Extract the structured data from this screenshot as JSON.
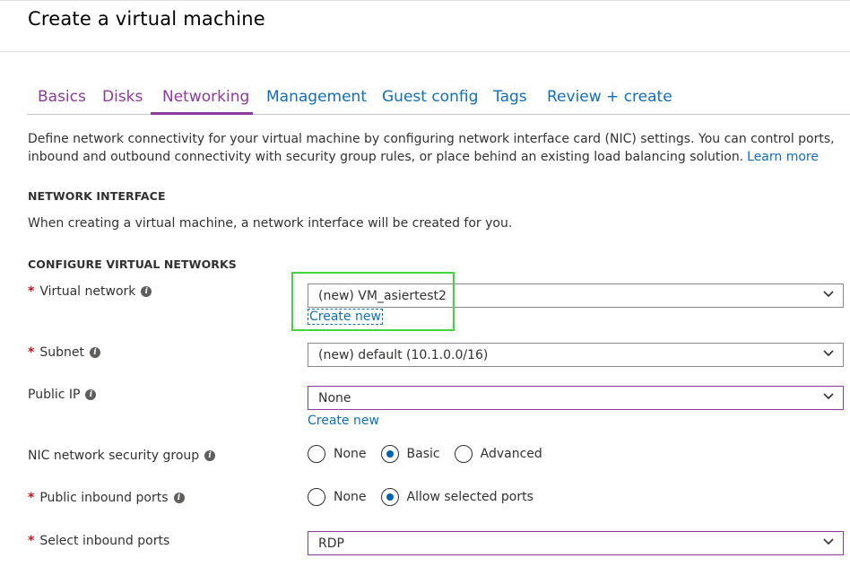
{
  "page": {
    "title": "Create a virtual machine"
  },
  "tabs": [
    {
      "label": "Basics"
    },
    {
      "label": "Disks"
    },
    {
      "label": "Networking"
    },
    {
      "label": "Management"
    },
    {
      "label": "Guest config"
    },
    {
      "label": "Tags"
    },
    {
      "label": "Review + create"
    }
  ],
  "description": {
    "text": "Define network connectivity for your virtual machine by configuring network interface card (NIC) settings. You can control ports, inbound and outbound connectivity with security group rules, or place behind an existing load balancing solution.",
    "learn_more": "Learn more"
  },
  "network_interface": {
    "heading": "NETWORK INTERFACE",
    "text": "When creating a virtual machine, a network interface will be created for you."
  },
  "configure_vnet": {
    "heading": "CONFIGURE VIRTUAL NETWORKS"
  },
  "fields": {
    "required_marker": "*",
    "info_glyph": "i",
    "virtual_network": {
      "label": "Virtual network",
      "value": "(new) VM_asiertest2",
      "create_new": "Create new"
    },
    "subnet": {
      "label": "Subnet",
      "value": "(new) default (10.1.0.0/16)"
    },
    "public_ip": {
      "label": "Public IP",
      "value": "None",
      "create_new": "Create new"
    },
    "nic_nsg": {
      "label": "NIC network security group",
      "options": [
        "None",
        "Basic",
        "Advanced"
      ],
      "selected": "Basic"
    },
    "public_inbound_ports": {
      "label": "Public inbound ports",
      "options": [
        "None",
        "Allow selected ports"
      ],
      "selected": "Allow selected ports"
    },
    "select_inbound_ports": {
      "label": "Select inbound ports",
      "value": "RDP"
    }
  },
  "colors": {
    "accent_purple": "#8c3a9d",
    "link_blue": "#106ebe",
    "highlight_green": "#3fd63f",
    "required_red": "#c4161c"
  }
}
